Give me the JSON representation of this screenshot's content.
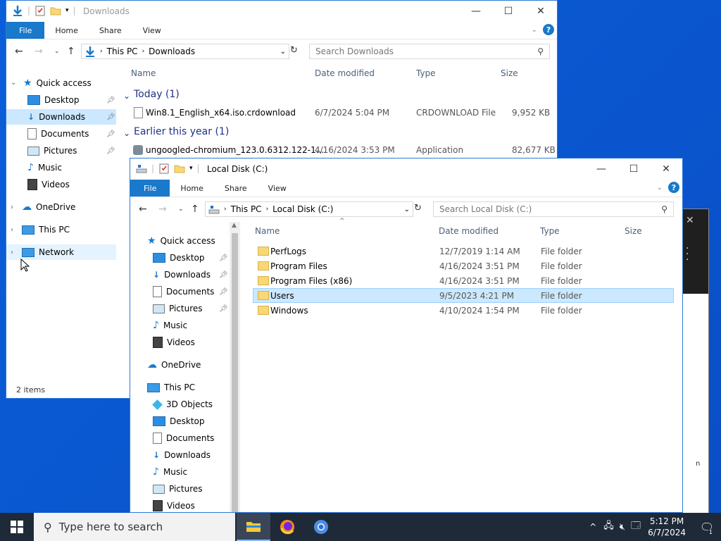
{
  "colors": {
    "accent": "#1979ca",
    "selection": "#cce8ff",
    "desktop": "#0a57d0",
    "taskbar": "#1f2a38"
  },
  "back_window": {
    "title": "Downloads",
    "ribbon_tabs": [
      "File",
      "Home",
      "Share",
      "View"
    ],
    "address": [
      "This PC",
      "Downloads"
    ],
    "search_placeholder": "Search Downloads",
    "columns": {
      "name": "Name",
      "date": "Date modified",
      "type": "Type",
      "size": "Size"
    },
    "groups": [
      {
        "label": "Today (1)",
        "items": [
          {
            "name": "Win8.1_English_x64.iso.crdownload",
            "date": "6/7/2024 5:04 PM",
            "type": "CRDOWNLOAD File",
            "size": "9,952 KB"
          }
        ]
      },
      {
        "label": "Earlier this year (1)",
        "items": [
          {
            "name": "ungoogled-chromium_123.0.6312.122-1....",
            "date": "4/16/2024 3:53 PM",
            "type": "Application",
            "size": "82,677 KB"
          }
        ]
      }
    ],
    "nav": {
      "quick_access": "Quick access",
      "items": [
        "Desktop",
        "Downloads",
        "Documents",
        "Pictures",
        "Music",
        "Videos"
      ],
      "onedrive": "OneDrive",
      "thispc": "This PC",
      "network": "Network"
    },
    "status": "2 items"
  },
  "front_window": {
    "title": "Local Disk (C:)",
    "ribbon_tabs": [
      "File",
      "Home",
      "Share",
      "View"
    ],
    "address": [
      "This PC",
      "Local Disk (C:)"
    ],
    "search_placeholder": "Search Local Disk (C:)",
    "columns": {
      "name": "Name",
      "date": "Date modified",
      "type": "Type",
      "size": "Size"
    },
    "rows": [
      {
        "name": "PerfLogs",
        "date": "12/7/2019 1:14 AM",
        "type": "File folder"
      },
      {
        "name": "Program Files",
        "date": "4/16/2024 3:51 PM",
        "type": "File folder"
      },
      {
        "name": "Program Files (x86)",
        "date": "4/16/2024 3:51 PM",
        "type": "File folder"
      },
      {
        "name": "Users",
        "date": "9/5/2023 4:21 PM",
        "type": "File folder"
      },
      {
        "name": "Windows",
        "date": "4/10/2024 1:54 PM",
        "type": "File folder"
      }
    ],
    "nav": {
      "quick_access": "Quick access",
      "qa_items": [
        "Desktop",
        "Downloads",
        "Documents",
        "Pictures",
        "Music",
        "Videos"
      ],
      "onedrive": "OneDrive",
      "thispc": "This PC",
      "pc_items": [
        "3D Objects",
        "Desktop",
        "Documents",
        "Downloads",
        "Music",
        "Pictures",
        "Videos"
      ]
    }
  },
  "taskbar": {
    "search_placeholder": "Type here to search",
    "time": "5:12 PM",
    "date": "6/7/2024",
    "notifications": "1"
  }
}
